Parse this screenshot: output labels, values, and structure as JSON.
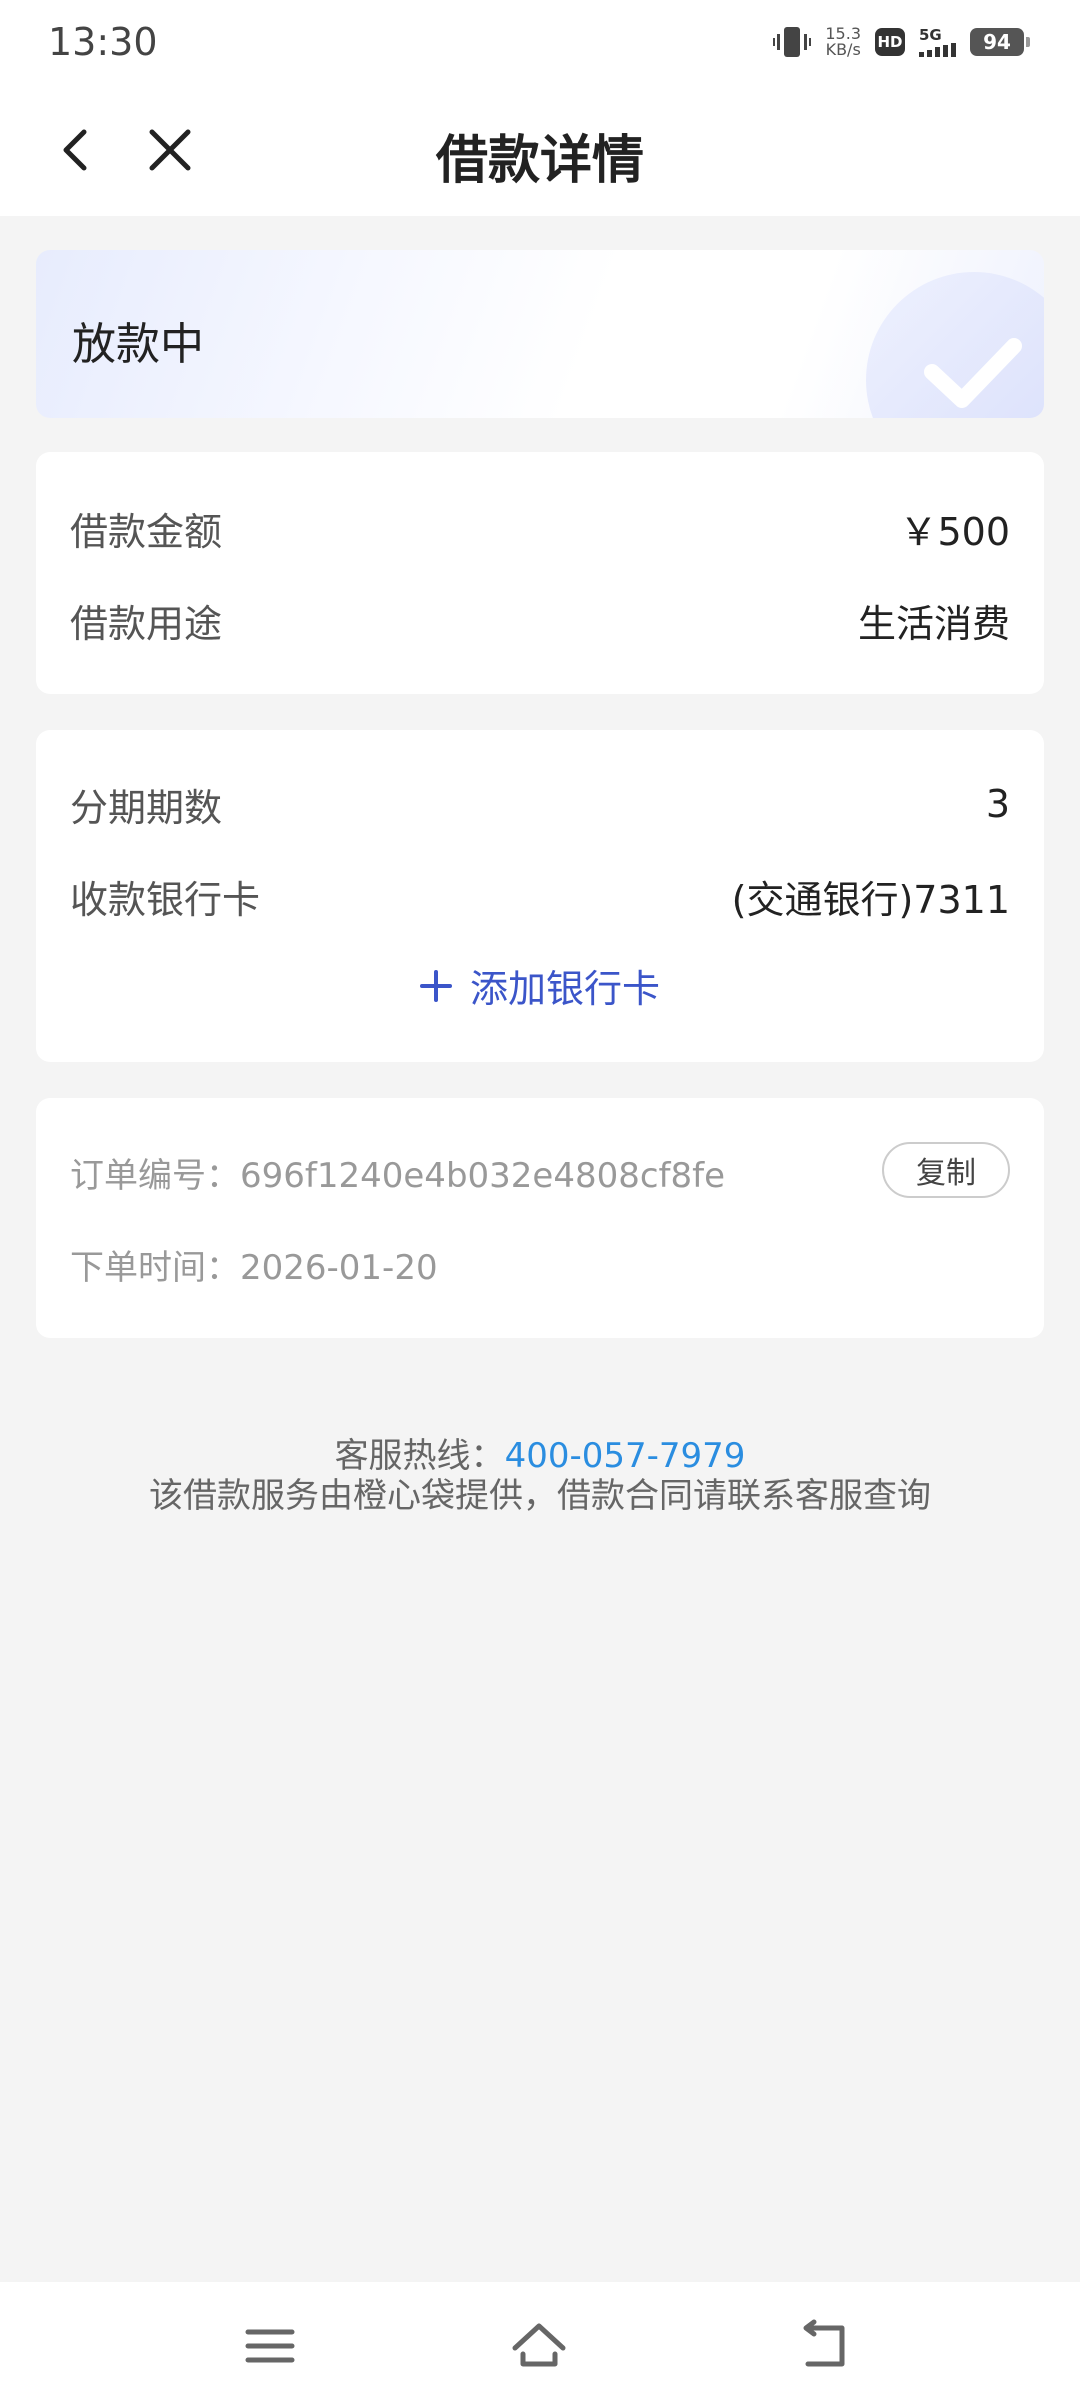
{
  "status_bar": {
    "time": "13:30",
    "net_speed_value": "15.3",
    "net_speed_unit": "KB/s",
    "hd": "HD",
    "network": "5G",
    "battery": "94"
  },
  "nav": {
    "title": "借款详情"
  },
  "status_card": {
    "status": "放款中"
  },
  "loan": {
    "amount_label": "借款金额",
    "amount_value": "￥500",
    "purpose_label": "借款用途",
    "purpose_value": "生活消费"
  },
  "installment": {
    "periods_label": "分期期数",
    "periods_value": "3",
    "bank_label": "收款银行卡",
    "bank_value": "(交通银行)7311",
    "add_card_label": "添加银行卡"
  },
  "order": {
    "number_text": "订单编号：696f1240e4b032e4808cf8fe",
    "copy_label": "复制",
    "time_text": "下单时间：2026-01-20"
  },
  "footer": {
    "hotline_label": "客服热线：",
    "hotline_number": "400-057-7979",
    "disclaimer": "该借款服务由橙心袋提供，借款合同请联系客服查询"
  },
  "colors": {
    "accent": "#3b55c9",
    "hotline": "#2a8de0",
    "background": "#f4f4f4"
  }
}
